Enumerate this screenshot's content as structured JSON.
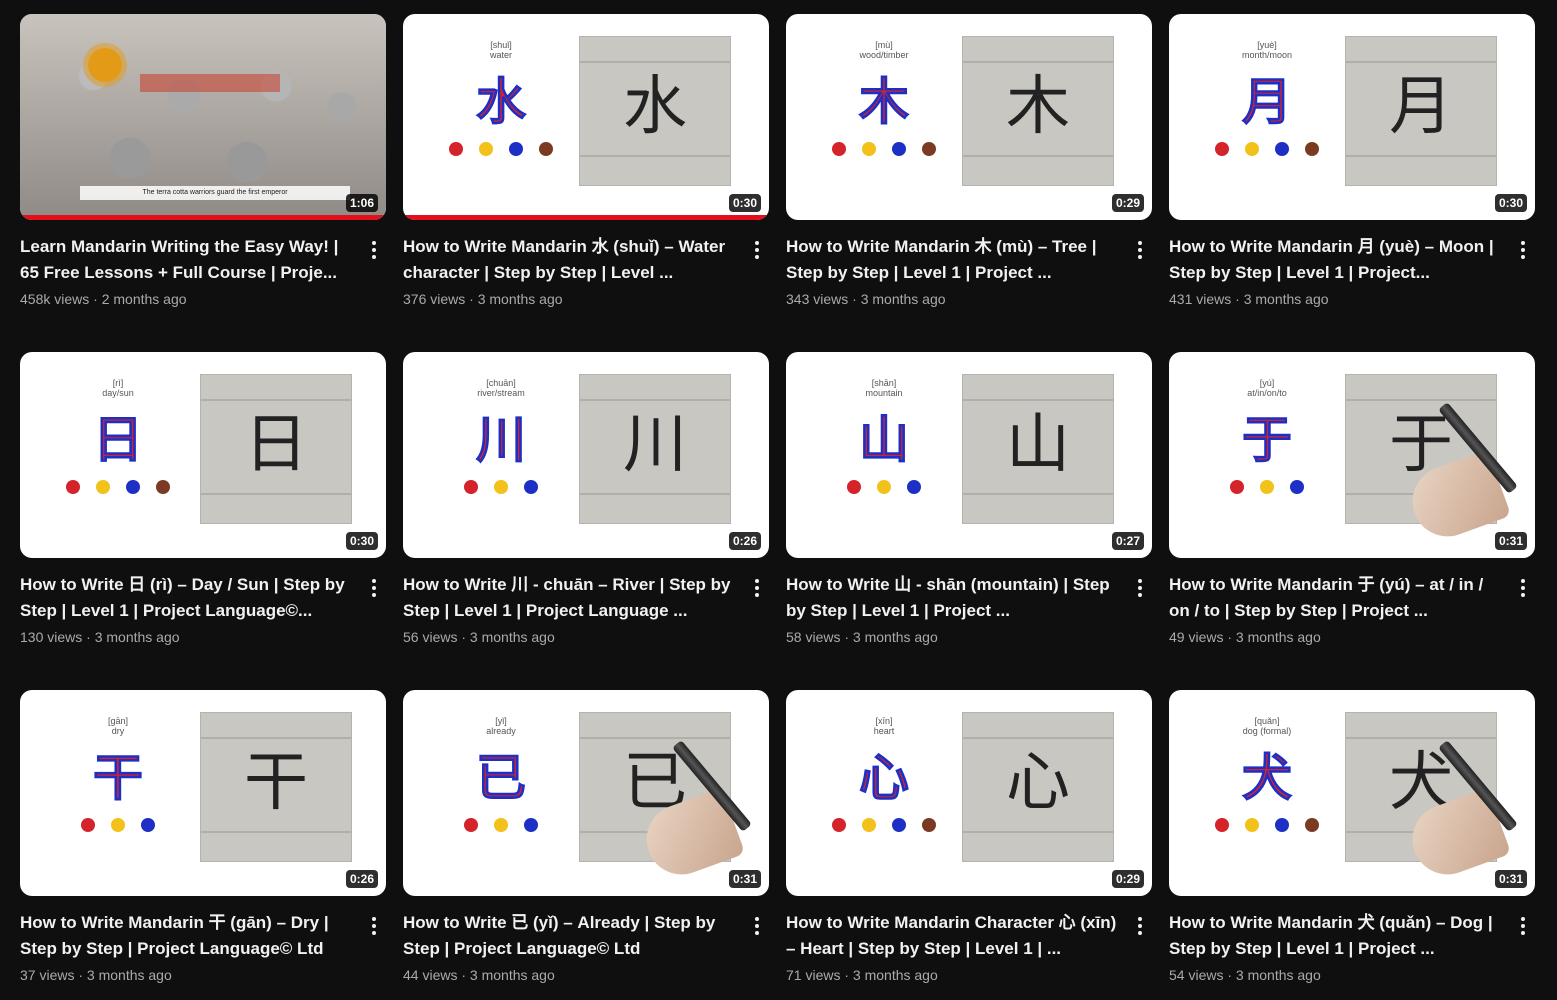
{
  "colors": {
    "red": "#d4232b",
    "yellow": "#f2c21a",
    "blue": "#1d2fc4",
    "brown": "#7a3b22",
    "progress": "#e3101b"
  },
  "videos": [
    {
      "type": "course",
      "title": "Learn Mandarin Writing the Easy Way! | 65 Free Lessons + Full Course | Proje...",
      "meta": "458k views · 2 months ago",
      "duration": "1:06",
      "progress": 1.0,
      "caption": "The terra cotta warriors guard the first emperor"
    },
    {
      "type": "lesson",
      "pinyin": "[shuǐ]",
      "gloss": "water",
      "char": "水",
      "title": "How to Write Mandarin 水 (shuǐ) – Water character | Step by Step | Level ...",
      "meta": "376 views · 3 months ago",
      "duration": "0:30",
      "progress": 1.0,
      "dots": [
        "red",
        "yellow",
        "blue",
        "brown"
      ],
      "hand": false
    },
    {
      "type": "lesson",
      "pinyin": "[mù]",
      "gloss": "wood/timber",
      "char": "木",
      "title": "How to Write Mandarin 木 (mù) – Tree | Step by Step | Level 1 | Project ...",
      "meta": "343 views · 3 months ago",
      "duration": "0:29",
      "dots": [
        "red",
        "yellow",
        "blue",
        "brown"
      ],
      "hand": false
    },
    {
      "type": "lesson",
      "pinyin": "[yuè]",
      "gloss": "month/moon",
      "char": "月",
      "title": "How to Write Mandarin 月 (yuè) – Moon | Step by Step | Level 1 | Project...",
      "meta": "431 views · 3 months ago",
      "duration": "0:30",
      "dots": [
        "red",
        "yellow",
        "blue",
        "brown"
      ],
      "hand": false
    },
    {
      "type": "lesson",
      "pinyin": "[rì]",
      "gloss": "day/sun",
      "char": "日",
      "title": "How to Write 日 (rì) – Day / Sun | Step by Step | Level 1 | Project Language©...",
      "meta": "130 views · 3 months ago",
      "duration": "0:30",
      "dots": [
        "red",
        "yellow",
        "blue",
        "brown"
      ],
      "hand": false
    },
    {
      "type": "lesson",
      "pinyin": "[chuān]",
      "gloss": "river/stream",
      "char": "川",
      "title": "How to Write 川 - chuān – River | Step by Step | Level 1 | Project Language ...",
      "meta": "56 views · 3 months ago",
      "duration": "0:26",
      "dots": [
        "red",
        "yellow",
        "blue"
      ],
      "hand": false
    },
    {
      "type": "lesson",
      "pinyin": "[shān]",
      "gloss": "mountain",
      "char": "山",
      "title": "How to Write 山 - shān (mountain) | Step by Step | Level 1 | Project ...",
      "meta": "58 views · 3 months ago",
      "duration": "0:27",
      "dots": [
        "red",
        "yellow",
        "blue"
      ],
      "hand": false
    },
    {
      "type": "lesson",
      "pinyin": "[yú]",
      "gloss": "at/in/on/to",
      "char": "于",
      "title": "How to Write  Mandarin 于 (yú) – at / in / on / to | Step by Step | Project ...",
      "meta": "49 views · 3 months ago",
      "duration": "0:31",
      "dots": [
        "red",
        "yellow",
        "blue"
      ],
      "hand": true
    },
    {
      "type": "lesson",
      "pinyin": "[gān]",
      "gloss": "dry",
      "char": "干",
      "title": "How to Write Mandarin 干 (gān) – Dry | Step by Step | Project Language© Ltd",
      "meta": "37 views · 3 months ago",
      "duration": "0:26",
      "dots": [
        "red",
        "yellow",
        "blue"
      ],
      "hand": false
    },
    {
      "type": "lesson",
      "pinyin": "[yǐ]",
      "gloss": "already",
      "char": "已",
      "title": "How to Write 已 (yǐ) – Already | Step by Step | Project Language© Ltd",
      "meta": "44 views · 3 months ago",
      "duration": "0:31",
      "dots": [
        "red",
        "yellow",
        "blue"
      ],
      "hand": true
    },
    {
      "type": "lesson",
      "pinyin": "[xīn]",
      "gloss": "heart",
      "char": "心",
      "title": "How to Write Mandarin Character 心 (xīn) – Heart | Step by Step | Level 1 | ...",
      "meta": "71 views · 3 months ago",
      "duration": "0:29",
      "dots": [
        "red",
        "yellow",
        "blue",
        "brown"
      ],
      "hand": false
    },
    {
      "type": "lesson",
      "pinyin": "[quǎn]",
      "gloss": "dog (formal)",
      "char": "犬",
      "title": "How to Write Mandarin 犬 (quǎn) – Dog | Step by Step | Level 1 | Project ...",
      "meta": "54 views · 3 months ago",
      "duration": "0:31",
      "dots": [
        "red",
        "yellow",
        "blue",
        "brown"
      ],
      "hand": true
    }
  ]
}
